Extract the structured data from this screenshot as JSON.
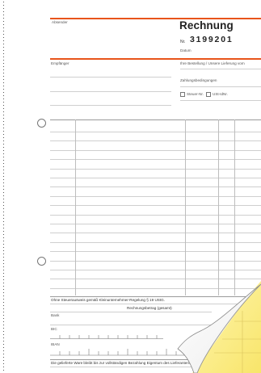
{
  "header": {
    "sender_label": "Absender",
    "title": "Rechnung",
    "number_prefix": "Nr.",
    "number": "3199201",
    "date_label": "Datum"
  },
  "address": {
    "recipient_label": "Empfänger",
    "order_label": "Ihre Bestellung / Unsere Lieferung vom",
    "payment_terms_label": "Zahlungsbedingungen",
    "tax_no_label": "Steuer-Nr.",
    "vat_id_label": "USt-IdNr."
  },
  "footer": {
    "tax_note": "Ohne Steuerausweis gemäß Kleinunternehmer-Regelung § 19 UStG.",
    "total_label": "Rechnungsbetrag (gesamt)",
    "bank_label": "Bank",
    "bic_label": "BIC",
    "iban_label": "IBAN",
    "ownership_note": "Die gelieferte Ware bleibt bis zur vollständigen Bezahlung Eigentum des Lieferanten."
  },
  "colors": {
    "accent": "#e8541b",
    "carbon_copy_yellow": "#fbf19a",
    "copy_white": "#ffffff"
  }
}
